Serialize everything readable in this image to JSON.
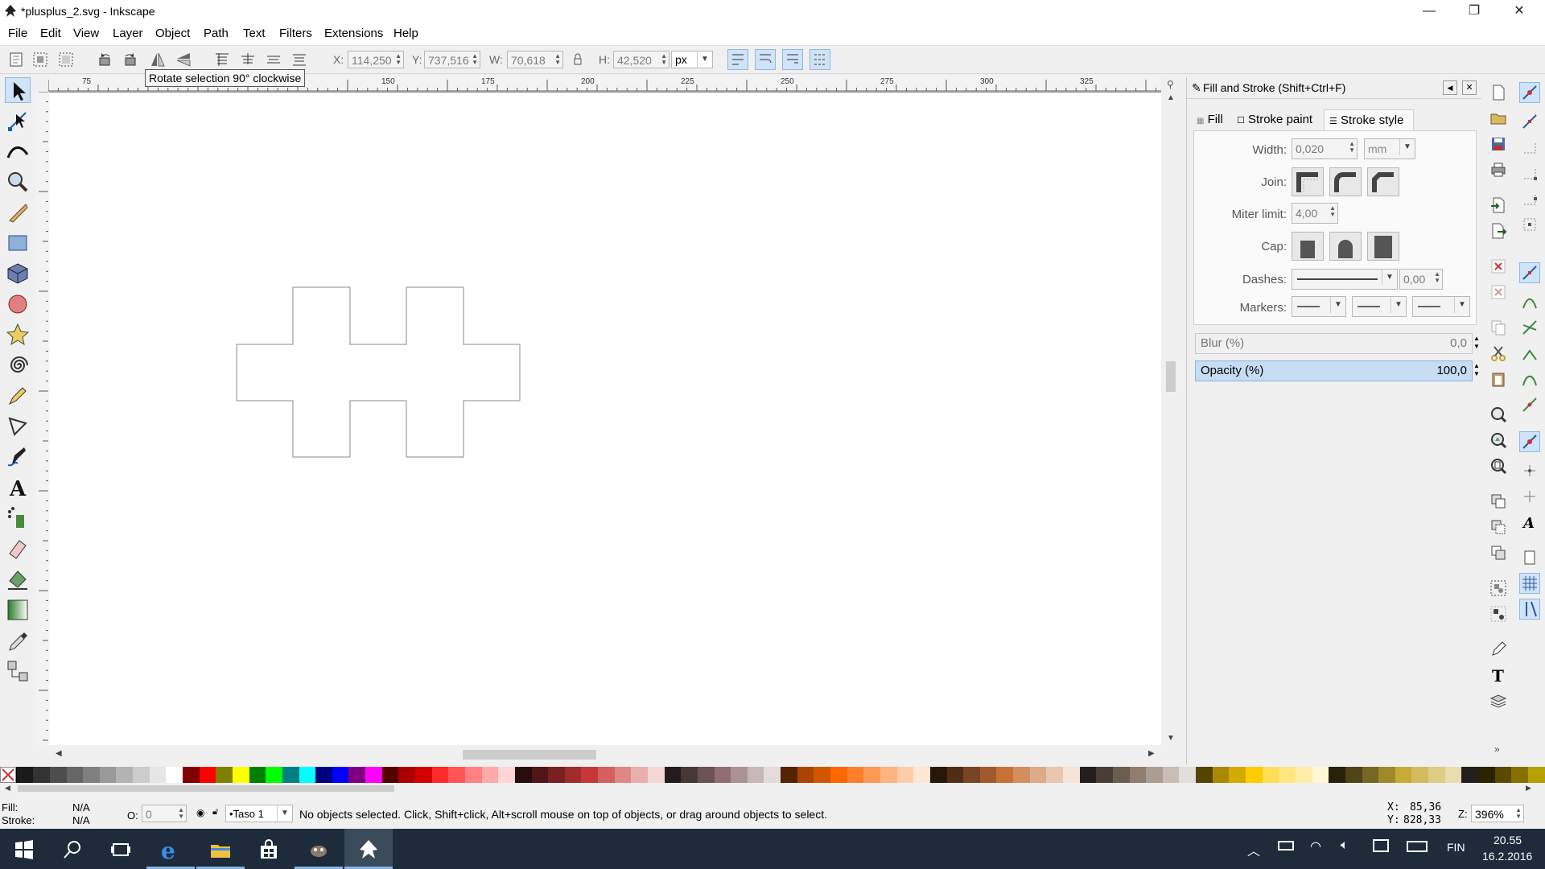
{
  "window": {
    "title": "*plusplus_2.svg - Inkscape",
    "minimize": "—",
    "maximize": "❐",
    "close": "✕"
  },
  "menu": [
    "File",
    "Edit",
    "View",
    "Layer",
    "Object",
    "Path",
    "Text",
    "Filters",
    "Extensions",
    "Help"
  ],
  "toolbar": {
    "x_label": "X:",
    "x_value": "114,250",
    "y_label": "Y:",
    "y_value": "737,516",
    "w_label": "W:",
    "w_value": "70,618",
    "h_label": "H:",
    "h_value": "42,520",
    "unit": "px",
    "tooltip": "Rotate selection 90° clockwise"
  },
  "ruler": {
    "h_labels": [
      "75",
      "150",
      "175",
      "200",
      "225",
      "250",
      "275",
      "300",
      "325"
    ]
  },
  "dock": {
    "title": "Fill and Stroke (Shift+Ctrl+F)",
    "tabs": [
      "Fill",
      "Stroke paint",
      "Stroke style"
    ],
    "width_label": "Width:",
    "width_value": "0,020",
    "width_unit": "mm",
    "join_label": "Join:",
    "miter_label": "Miter limit:",
    "miter_value": "4,00",
    "cap_label": "Cap:",
    "dashes_label": "Dashes:",
    "dashes_value": "0,00",
    "markers_label": "Markers:",
    "blur_label": "Blur (%)",
    "blur_value": "0,0",
    "opacity_label": "Opacity (%)",
    "opacity_value": "100,0"
  },
  "status": {
    "fill_label": "Fill:",
    "fill_value": "N/A",
    "stroke_label": "Stroke:",
    "stroke_value": "N/A",
    "o_label": "O:",
    "o_value": "0",
    "layer": "•Taso 1",
    "message": "No objects selected. Click, Shift+click, Alt+scroll mouse on top of objects, or drag around objects to select.",
    "cx_label": "X:",
    "cx_value": "85,36",
    "cy_label": "Y:",
    "cy_value": "828,33",
    "zoom_label": "Z:",
    "zoom_value": "396%"
  },
  "taskbar": {
    "time": "20.55",
    "date": "16.2.2016",
    "lang": "FIN"
  },
  "palette": [
    "#000000",
    "#1a1a1a",
    "#333333",
    "#4d4d4d",
    "#666666",
    "#808080",
    "#999999",
    "#b3b3b3",
    "#cccccc",
    "#e6e6e6",
    "#ffffff",
    "#800000",
    "#ff0000",
    "#808000",
    "#ffff00",
    "#008000",
    "#00ff00",
    "#008080",
    "#00ffff",
    "#000080",
    "#0000ff",
    "#800080",
    "#ff00ff",
    "#550000",
    "#aa0000",
    "#d40000",
    "#ff2a2a",
    "#ff5555",
    "#ff8080",
    "#ffaaaa",
    "#ffd5d5",
    "#280b0b",
    "#501616",
    "#782121",
    "#a02c2c",
    "#c83737",
    "#d35f5f",
    "#de8787",
    "#e9afaf",
    "#f4d7d7",
    "#241c1c",
    "#483737",
    "#6c5353",
    "#916f6f",
    "#ac9393",
    "#c8b7b7",
    "#e3dbdb",
    "#552200",
    "#aa4400",
    "#d45500",
    "#ff6600",
    "#ff7f2a",
    "#ff9955",
    "#ffb380",
    "#ffccaa",
    "#ffe6d5",
    "#28170b",
    "#502d16",
    "#784421",
    "#a05a2c",
    "#c87137",
    "#d38d5f",
    "#deaa87",
    "#e9c6af",
    "#f4e3d7",
    "#241f1c",
    "#483e37",
    "#6c5d53",
    "#917c6f",
    "#ac9d93",
    "#c8beb7",
    "#e3dedb",
    "#554400",
    "#aa8800",
    "#d4aa00",
    "#ffcc00",
    "#ffdd55",
    "#ffe680",
    "#ffeeaa",
    "#fff6d5",
    "#28220b",
    "#504416",
    "#786721",
    "#a0892c",
    "#c8ab37",
    "#d3bc5f",
    "#decd87",
    "#e9ddaf",
    "#241f1c",
    "#2b2200",
    "#5a4a00",
    "#887000",
    "#b5a000"
  ]
}
